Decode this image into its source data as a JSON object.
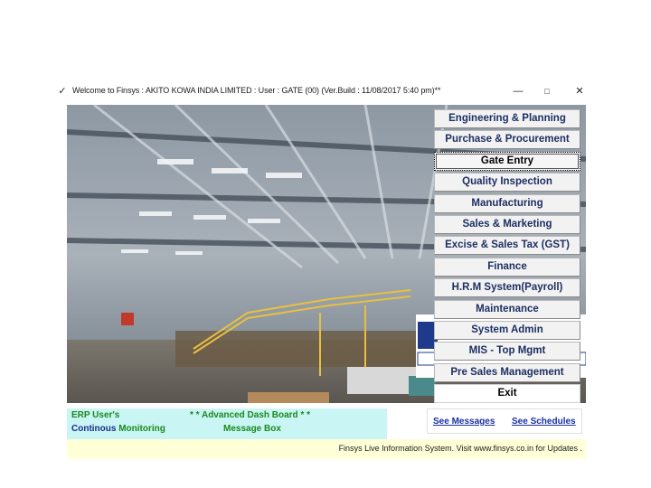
{
  "window": {
    "title": "Welcome to Finsys : AKITO KOWA INDIA LIMITED : User : GATE (00) (Ver.Build : 11/08/2017 5:40 pm)**",
    "icon": "app-icon",
    "minimize": "—",
    "maximize": "□",
    "close": "✕"
  },
  "menu": {
    "items": [
      {
        "label": "Engineering & Planning"
      },
      {
        "label": "Purchase & Procurement"
      },
      {
        "label": "Gate Entry"
      },
      {
        "label": "Quality Inspection"
      },
      {
        "label": "Manufacturing"
      },
      {
        "label": "Sales & Marketing"
      },
      {
        "label": "Excise & Sales Tax (GST)"
      },
      {
        "label": "Finance"
      },
      {
        "label": "H.R.M System(Payroll)"
      },
      {
        "label": "Maintenance"
      },
      {
        "label": "System Admin"
      },
      {
        "label": "MIS - Top Mgmt"
      },
      {
        "label": "Pre Sales Management"
      },
      {
        "label": "Exit"
      }
    ],
    "active_index": 2
  },
  "bottom_panel": {
    "erp_users": "ERP User's",
    "advanced_dash": "* * Advanced Dash Board * *",
    "continous_prefix": "Continous ",
    "continous_suffix": "Monitoring",
    "message_box": "Message Box"
  },
  "links": {
    "see_messages": "See Messages",
    "see_schedules": "See Schedules"
  },
  "status": {
    "text": "Finsys Live Information System. Visit www.finsys.co.in for Updates ."
  },
  "colors": {
    "menu_text": "#1e2f63",
    "dash_green": "#1a8a1a",
    "panel_cyan": "#c9f5f5",
    "status_yellow": "#ffffd8",
    "link_blue": "#1a2fa0"
  }
}
